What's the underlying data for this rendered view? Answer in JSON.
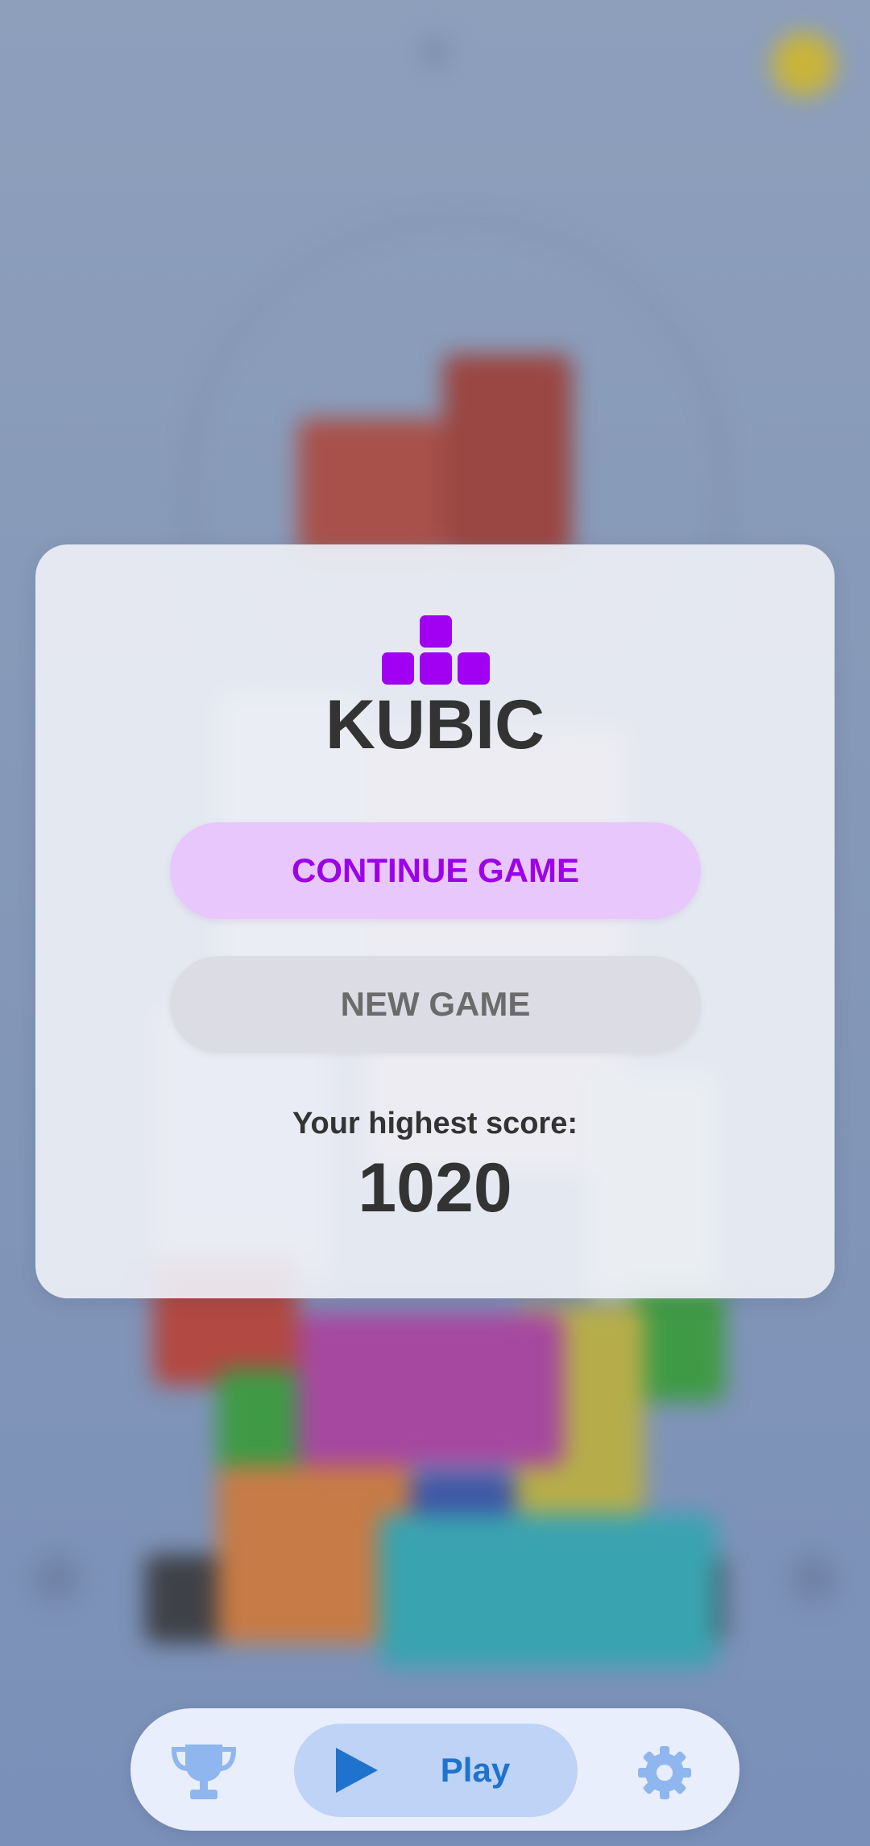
{
  "app": {
    "title": "KUBIC"
  },
  "menu": {
    "continue_label": "CONTINUE GAME",
    "new_game_label": "NEW GAME"
  },
  "score": {
    "label": "Your highest score:",
    "value": "1020"
  },
  "bottom_nav": {
    "leaderboard_icon": "trophy-icon",
    "play_icon": "play-icon",
    "play_label": "Play",
    "settings_icon": "gear-icon"
  },
  "colors": {
    "brand_purple": "#a100f2",
    "continue_bg": "#e7c7fc",
    "new_game_bg": "#dcdde4",
    "play_blue": "#1f73cc",
    "nav_bg": "#e8eefb"
  }
}
